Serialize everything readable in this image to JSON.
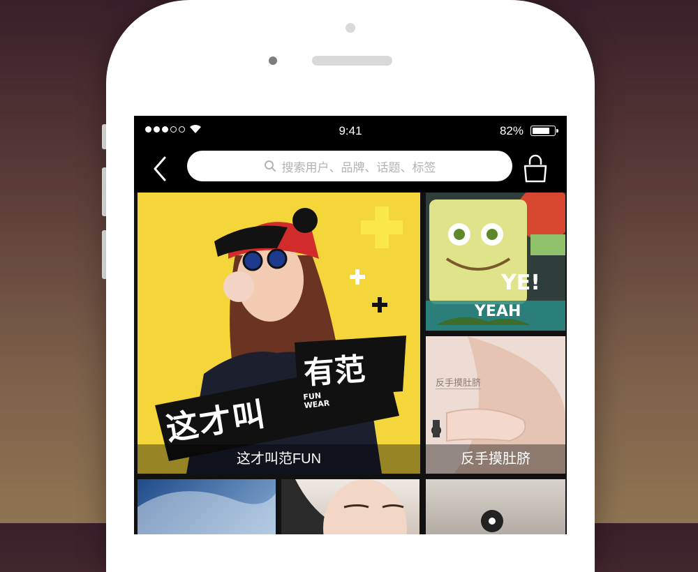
{
  "status_bar": {
    "time": "9:41",
    "battery_percent": "82%",
    "battery_level": 0.82,
    "signal_dots_filled": 3,
    "signal_dots_total": 5
  },
  "nav": {
    "search_placeholder": "搜索用户、品牌、话题、标签"
  },
  "tiles": [
    {
      "caption": "这才叫范FUN",
      "headline": "这才叫",
      "headline2": "有范",
      "brand_small": "FUN WEAR"
    },
    {
      "caption": "",
      "overlay_text": "YE!",
      "overlay_text2": "YEAH"
    },
    {
      "caption": "反手摸肚脐",
      "overlay_text": "反手摸肚脐"
    },
    {
      "caption": ""
    },
    {
      "caption": ""
    },
    {
      "caption": ""
    }
  ],
  "colors": {
    "accent_yellow": "#f4d63b",
    "screen_bg": "#000000"
  }
}
